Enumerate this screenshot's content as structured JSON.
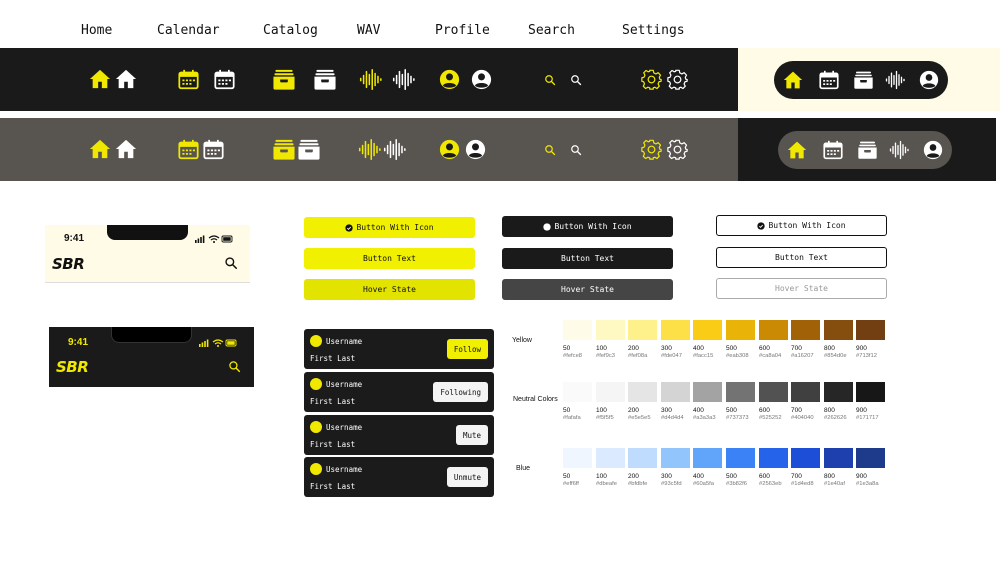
{
  "nav": {
    "items": [
      "Home",
      "Calendar",
      "Catalog",
      "WAV",
      "Profile",
      "Search",
      "Settings"
    ]
  },
  "colors": {
    "yellow": "#f0e800",
    "dark_band": "#1a1a1a",
    "gray_band": "#585450",
    "cream": "#fffbe6"
  },
  "icons": [
    "home-icon",
    "calendar-icon",
    "catalog-icon",
    "wav-icon",
    "profile-icon",
    "search-icon",
    "settings-icon"
  ],
  "buttons": {
    "with_icon": "Button With Icon",
    "text": "Button Text",
    "hover": "Hover State"
  },
  "phones": {
    "light": {
      "time": "9:41",
      "logo": "SBR"
    },
    "dark": {
      "time": "9:41",
      "logo": "SBR"
    }
  },
  "user_cards": [
    {
      "username": "Username",
      "name": "First Last",
      "action": "Follow"
    },
    {
      "username": "Username",
      "name": "First Last",
      "action": "Following"
    },
    {
      "username": "Username",
      "name": "First Last",
      "action": "Mute"
    },
    {
      "username": "Username",
      "name": "First Last",
      "action": "Unmute"
    }
  ],
  "palettes": [
    {
      "name": "Yellow",
      "shades": [
        {
          "step": "50",
          "hex": "#fefce8"
        },
        {
          "step": "100",
          "hex": "#fef9c3"
        },
        {
          "step": "200",
          "hex": "#fef08a"
        },
        {
          "step": "300",
          "hex": "#fde047"
        },
        {
          "step": "400",
          "hex": "#facc15"
        },
        {
          "step": "500",
          "hex": "#eab308"
        },
        {
          "step": "600",
          "hex": "#ca8a04"
        },
        {
          "step": "700",
          "hex": "#a16207"
        },
        {
          "step": "800",
          "hex": "#854d0e"
        },
        {
          "step": "900",
          "hex": "#713f12"
        }
      ]
    },
    {
      "name": "Neutral Colors",
      "shades": [
        {
          "step": "50",
          "hex": "#fafafa"
        },
        {
          "step": "100",
          "hex": "#f5f5f5"
        },
        {
          "step": "200",
          "hex": "#e5e5e5"
        },
        {
          "step": "300",
          "hex": "#d4d4d4"
        },
        {
          "step": "400",
          "hex": "#a3a3a3"
        },
        {
          "step": "500",
          "hex": "#737373"
        },
        {
          "step": "600",
          "hex": "#525252"
        },
        {
          "step": "700",
          "hex": "#404040"
        },
        {
          "step": "800",
          "hex": "#262626"
        },
        {
          "step": "900",
          "hex": "#171717"
        }
      ]
    },
    {
      "name": "Blue",
      "shades": [
        {
          "step": "50",
          "hex": "#eff6ff"
        },
        {
          "step": "100",
          "hex": "#dbeafe"
        },
        {
          "step": "200",
          "hex": "#bfdbfe"
        },
        {
          "step": "300",
          "hex": "#93c5fd"
        },
        {
          "step": "400",
          "hex": "#60a5fa"
        },
        {
          "step": "500",
          "hex": "#3b82f6"
        },
        {
          "step": "600",
          "hex": "#2563eb"
        },
        {
          "step": "700",
          "hex": "#1d4ed8"
        },
        {
          "step": "800",
          "hex": "#1e40af"
        },
        {
          "step": "900",
          "hex": "#1e3a8a"
        }
      ]
    }
  ]
}
